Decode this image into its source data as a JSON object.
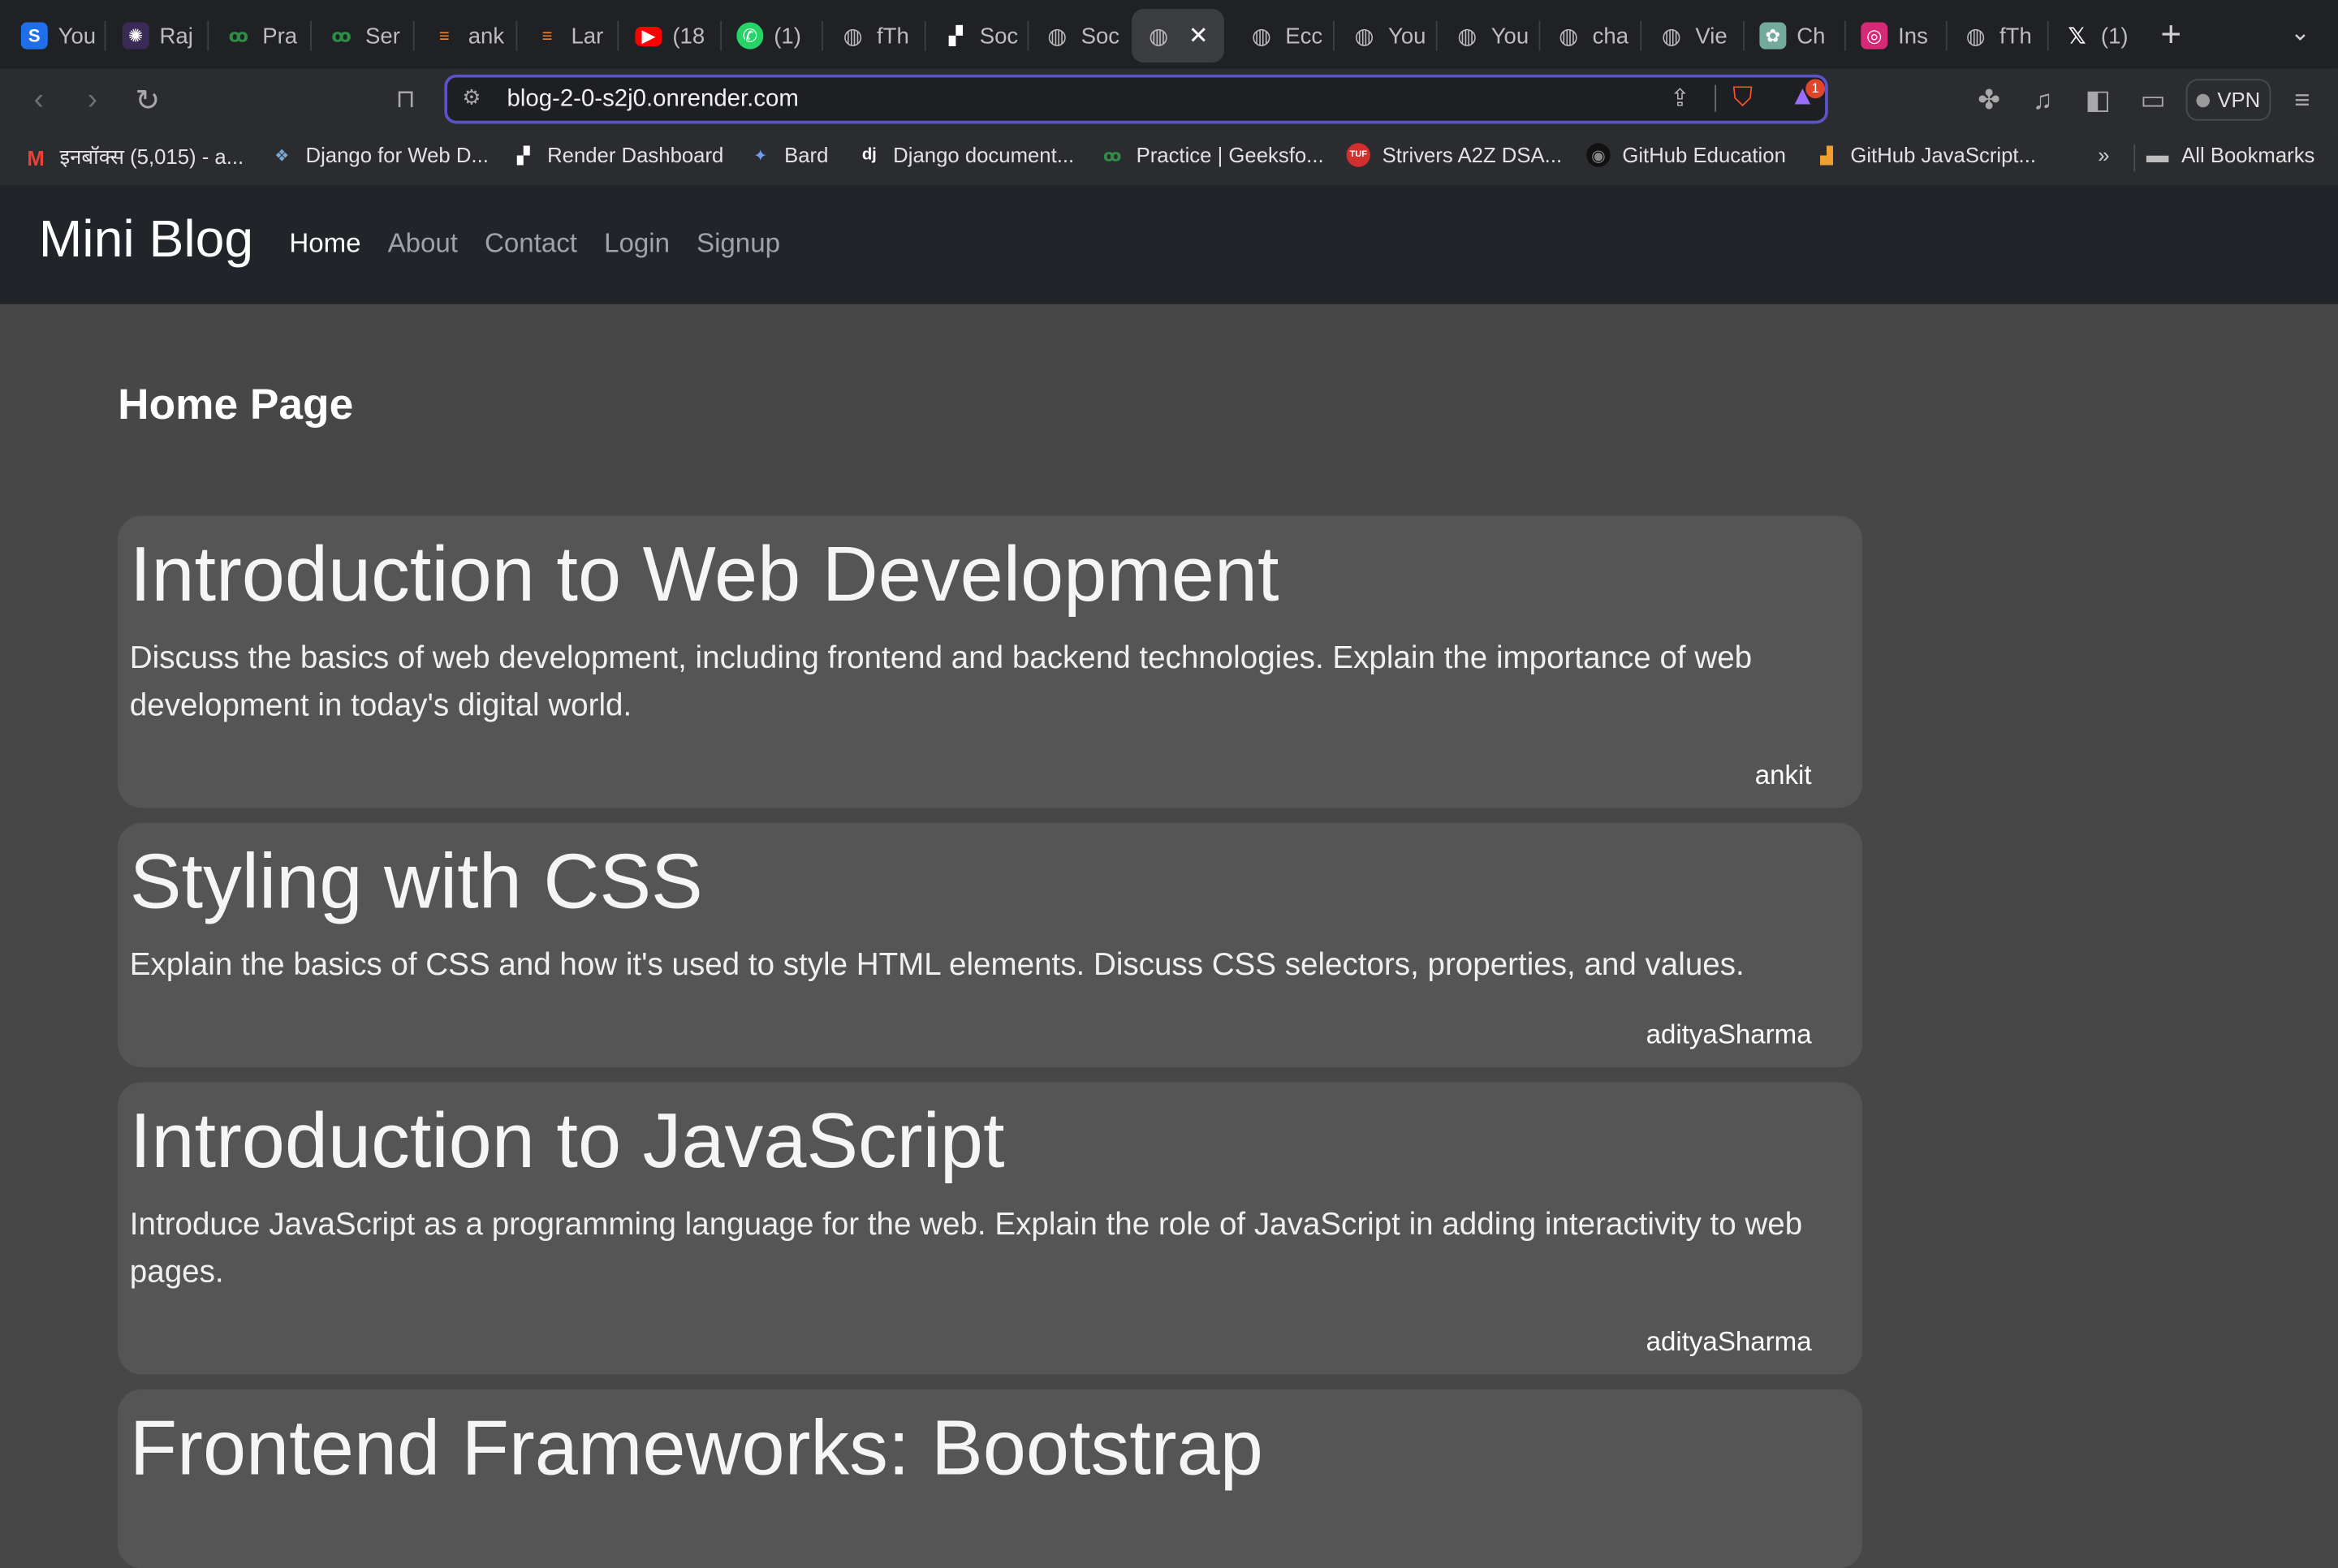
{
  "browser": {
    "tabs": [
      {
        "label": "You",
        "icon": "s-logo-icon",
        "color": "#1f6feb"
      },
      {
        "label": "Raj",
        "icon": "avatar-icon",
        "color": "#6b3fa0"
      },
      {
        "label": "Pra",
        "icon": "gfg-icon",
        "color": "#2f8d46"
      },
      {
        "label": "Ser",
        "icon": "gfg-icon",
        "color": "#2f8d46"
      },
      {
        "label": "ank",
        "icon": "stack-icon",
        "color": "#f48024"
      },
      {
        "label": "Lar",
        "icon": "stack-icon",
        "color": "#f48024"
      },
      {
        "label": "(18",
        "icon": "youtube-icon",
        "color": "#ff0000"
      },
      {
        "label": "(1)",
        "icon": "whatsapp-icon",
        "color": "#25d366"
      },
      {
        "label": "fTh",
        "icon": "globe-icon",
        "color": "#5f6368"
      },
      {
        "label": "Soc",
        "icon": "render-icon",
        "color": "#ffffff"
      },
      {
        "label": "Soc",
        "icon": "globe-icon",
        "color": "#5f6368"
      },
      {
        "label": "",
        "icon": "globe-icon",
        "color": "#5f6368",
        "active": true
      },
      {
        "label": "Ecc",
        "icon": "globe-icon",
        "color": "#5f6368"
      },
      {
        "label": "You",
        "icon": "globe-icon",
        "color": "#5f6368"
      },
      {
        "label": "You",
        "icon": "globe-icon",
        "color": "#5f6368"
      },
      {
        "label": "cha",
        "icon": "globe-icon",
        "color": "#5f6368"
      },
      {
        "label": "Vie",
        "icon": "globe-icon",
        "color": "#5f6368"
      },
      {
        "label": "Ch",
        "icon": "chatgpt-icon",
        "color": "#74aa9c"
      },
      {
        "label": "Ins",
        "icon": "instagram-icon",
        "color": "#d62976"
      },
      {
        "label": "fTh",
        "icon": "globe-icon",
        "color": "#5f6368"
      },
      {
        "label": "(1)",
        "icon": "x-icon",
        "color": "#000000"
      }
    ],
    "url": "blog-2-0-s2j0.onrender.com",
    "shield_badge": "1",
    "vpn_label": "VPN",
    "bookmarks": [
      {
        "label": "इनबॉक्स (5,015) - a...",
        "icon": "gmail-icon"
      },
      {
        "label": "Django for Web D...",
        "icon": "python-icon"
      },
      {
        "label": "Render Dashboard",
        "icon": "render-icon"
      },
      {
        "label": "Bard",
        "icon": "bard-icon"
      },
      {
        "label": "Django document...",
        "icon": "django-icon"
      },
      {
        "label": "Practice | Geeksfo...",
        "icon": "gfg-icon"
      },
      {
        "label": "Strivers A2Z DSA...",
        "icon": "tuf-icon"
      },
      {
        "label": "GitHub Education",
        "icon": "github-icon"
      },
      {
        "label": "GitHub JavaScript...",
        "icon": "chart-icon"
      }
    ],
    "bookmarks_overflow": "»",
    "all_bookmarks": "All Bookmarks"
  },
  "site": {
    "brand": "Mini Blog",
    "nav": [
      {
        "label": "Home",
        "current": true
      },
      {
        "label": "About"
      },
      {
        "label": "Contact"
      },
      {
        "label": "Login"
      },
      {
        "label": "Signup"
      }
    ],
    "page_title": "Home Page",
    "posts": [
      {
        "title": "Introduction to Web Development",
        "description": "Discuss the basics of web development, including frontend and backend technologies. Explain the importance of web development in today's digital world.",
        "author": "ankit"
      },
      {
        "title": "Styling with CSS",
        "description": "Explain the basics of CSS and how it's used to style HTML elements. Discuss CSS selectors, properties, and values.",
        "author": "adityaSharma"
      },
      {
        "title": "Introduction to JavaScript",
        "description": "Introduce JavaScript as a programming language for the web. Explain the role of JavaScript in adding interactivity to web pages.",
        "author": "adityaSharma"
      },
      {
        "title": "Frontend Frameworks: Bootstrap",
        "description": "",
        "author": ""
      }
    ]
  }
}
